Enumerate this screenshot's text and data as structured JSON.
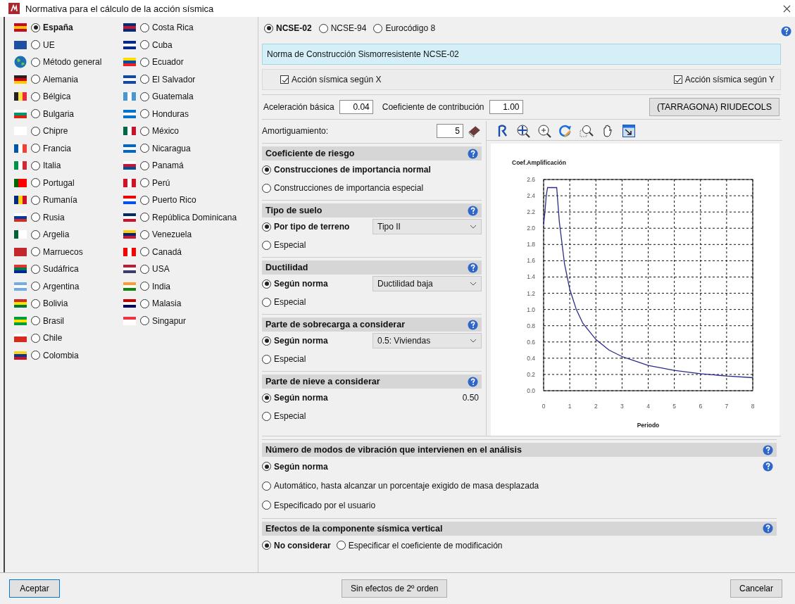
{
  "window": {
    "title": "Normativa para el cálculo de la acción sísmica"
  },
  "countries": {
    "columns": [
      [
        {
          "label": "España",
          "selected": true
        },
        {
          "label": "UE",
          "selected": false
        },
        {
          "label": "Método general",
          "selected": false
        },
        {
          "label": "Alemania",
          "selected": false
        },
        {
          "label": "Bélgica",
          "selected": false
        },
        {
          "label": "Bulgaria",
          "selected": false
        },
        {
          "label": "Chipre",
          "selected": false
        },
        {
          "label": "Francia",
          "selected": false
        },
        {
          "label": "Italia",
          "selected": false
        },
        {
          "label": "Portugal",
          "selected": false
        },
        {
          "label": "Rumanía",
          "selected": false
        },
        {
          "label": "Rusia",
          "selected": false
        },
        {
          "label": "Argelia",
          "selected": false
        },
        {
          "label": "Marruecos",
          "selected": false
        },
        {
          "label": "Sudáfrica",
          "selected": false
        },
        {
          "label": "Argentina",
          "selected": false
        },
        {
          "label": "Bolivia",
          "selected": false
        },
        {
          "label": "Brasil",
          "selected": false
        },
        {
          "label": "Chile",
          "selected": false
        },
        {
          "label": "Colombia",
          "selected": false
        }
      ],
      [
        {
          "label": "Costa Rica",
          "selected": false
        },
        {
          "label": "Cuba",
          "selected": false
        },
        {
          "label": "Ecuador",
          "selected": false
        },
        {
          "label": "El Salvador",
          "selected": false
        },
        {
          "label": "Guatemala",
          "selected": false
        },
        {
          "label": "Honduras",
          "selected": false
        },
        {
          "label": "México",
          "selected": false
        },
        {
          "label": "Nicaragua",
          "selected": false
        },
        {
          "label": "Panamá",
          "selected": false
        },
        {
          "label": "Perú",
          "selected": false
        },
        {
          "label": "Puerto Rico",
          "selected": false
        },
        {
          "label": "República Dominicana",
          "selected": false
        },
        {
          "label": "Venezuela",
          "selected": false
        },
        {
          "label": "Canadá",
          "selected": false
        },
        {
          "label": "USA",
          "selected": false
        },
        {
          "label": "India",
          "selected": false
        },
        {
          "label": "Malasia",
          "selected": false
        },
        {
          "label": "Singapur",
          "selected": false
        }
      ]
    ]
  },
  "norms": [
    {
      "label": "NCSE-02",
      "selected": true
    },
    {
      "label": "NCSE-94",
      "selected": false
    },
    {
      "label": "Eurocódigo 8",
      "selected": false
    }
  ],
  "norm_description": "Norma de Construcción Sismorresistente NCSE-02",
  "seismic_x": {
    "label": "Acción sísmica según X",
    "checked": true
  },
  "seismic_y": {
    "label": "Acción sísmica según Y",
    "checked": true
  },
  "basic_acceleration": {
    "label": "Aceleración básica",
    "value": "0.04"
  },
  "contribution_coefficient": {
    "label": "Coeficiente de contribución",
    "value": "1.00"
  },
  "location_button": "(TARRAGONA) RIUDECOLS",
  "damping": {
    "label": "Amortiguamiento:",
    "value": "5"
  },
  "sections": [
    {
      "title": "Coeficiente de riesgo",
      "options": [
        {
          "label": "Construcciones de importancia normal",
          "selected": true
        },
        {
          "label": "Construcciones de importancia especial",
          "selected": false
        }
      ]
    },
    {
      "title": "Tipo de suelo",
      "options": [
        {
          "label": "Por tipo de terreno",
          "selected": true,
          "dropdown": "Tipo II"
        },
        {
          "label": "Especial",
          "selected": false
        }
      ]
    },
    {
      "title": "Ductilidad",
      "options": [
        {
          "label": "Según norma",
          "selected": true,
          "dropdown": "Ductilidad baja"
        },
        {
          "label": "Especial",
          "selected": false
        }
      ]
    },
    {
      "title": "Parte de sobrecarga a considerar",
      "options": [
        {
          "label": "Según norma",
          "selected": true,
          "dropdown": "0.5: Viviendas"
        },
        {
          "label": "Especial",
          "selected": false
        }
      ]
    },
    {
      "title": "Parte de nieve a considerar",
      "options": [
        {
          "label": "Según norma",
          "selected": true,
          "value": "0.50"
        },
        {
          "label": "Especial",
          "selected": false
        }
      ]
    }
  ],
  "chart": {
    "chart_data": {
      "type": "line",
      "xlabel": "Periodo",
      "ylabel": "Coef.Amplificación",
      "x": [
        0,
        0.05,
        0.1,
        0.15,
        0.5,
        0.6,
        0.8,
        1,
        1.25,
        1.5,
        2,
        2.5,
        3,
        4,
        5,
        6,
        7,
        8
      ],
      "series": [
        {
          "color": "#2a2a8a",
          "values": [
            2.05,
            2.2,
            2.4,
            2.5,
            2.5,
            2.08,
            1.56,
            1.25,
            1.0,
            0.83,
            0.63,
            0.5,
            0.42,
            0.31,
            0.25,
            0.21,
            0.18,
            0.16
          ]
        }
      ],
      "grid": true,
      "xlim": [
        0,
        8
      ],
      "ylim": [
        0,
        2.6
      ],
      "xticks": [
        0,
        1,
        2,
        3,
        4,
        5,
        6,
        7,
        8
      ],
      "yticks": [
        {
          "value": 0,
          "label": "0.0"
        },
        {
          "value": 0.2,
          "label": "0.2"
        },
        {
          "value": 0.4,
          "label": "0.4"
        },
        {
          "value": 0.6,
          "label": "0.6"
        },
        {
          "value": 0.8,
          "label": "0.8"
        },
        {
          "value": 1,
          "label": "1.0"
        },
        {
          "value": 1.2,
          "label": "1.2"
        },
        {
          "value": 1.4,
          "label": "1.4"
        },
        {
          "value": 1.6,
          "label": "1.6"
        },
        {
          "value": 1.8,
          "label": "1.8"
        },
        {
          "value": 2,
          "label": "2.0"
        },
        {
          "value": 2.2,
          "label": "2.2"
        },
        {
          "value": 2.4,
          "label": "2.4"
        },
        {
          "value": 2.6,
          "label": "2.6"
        }
      ]
    }
  },
  "wide_sections": [
    {
      "title": "Número de modos de vibración que intervienen en el análisis",
      "inline": false,
      "options": [
        {
          "label": "Según norma",
          "selected": true,
          "help": true
        },
        {
          "label": "Automático, hasta alcanzar un porcentaje exigido de masa desplazada",
          "selected": false,
          "help": false
        },
        {
          "label": "Especificado por el usuario",
          "selected": false,
          "help": false
        }
      ]
    },
    {
      "title": "Efectos de la componente sísmica vertical",
      "inline": true,
      "options": [
        {
          "label": "No considerar",
          "selected": true,
          "help": false
        },
        {
          "label": "Especificar el coeficiente de modificación",
          "selected": false,
          "help": false
        }
      ]
    }
  ],
  "buttons": {
    "accept": "Aceptar",
    "second_order": "Sin efectos de 2º orden",
    "cancel": "Cancelar"
  }
}
